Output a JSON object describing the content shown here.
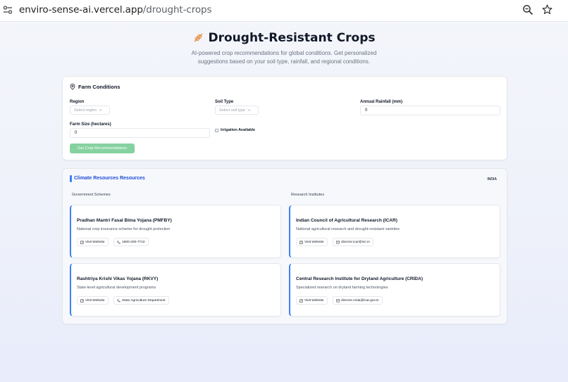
{
  "browser": {
    "url_host": "enviro-sense-ai.vercel.app",
    "url_path": "/drought-crops"
  },
  "header": {
    "title": "Drought-Resistant Crops",
    "subtitle": "AI-powered crop recommendations for global conditions. Get personalized suggestions based on your soil type, rainfall, and regional conditions."
  },
  "farm": {
    "title": "Farm Conditions",
    "region_label": "Region",
    "region_placeholder": "Select region",
    "soil_label": "Soil Type",
    "soil_placeholder": "Select soil type",
    "rainfall_label": "Annual Rainfall (mm)",
    "rainfall_value": "0",
    "size_label": "Farm Size (hectares)",
    "size_value": "0",
    "irrigation_label": "Irrigation Available",
    "submit_label": "Get Crop Recommendations"
  },
  "resources": {
    "title": "Climate Resources Resources",
    "country": "INDIA",
    "gov_heading": "Government Schemes",
    "research_heading": "Research Institutes",
    "items": [
      {
        "name": "Pradhan Mantri Fasal Bima Yojana (PMFBY)",
        "desc": "National crop insurance scheme for drought protection",
        "website": "Visit Website",
        "contact": "1800-200-7710",
        "contact_type": "phone"
      },
      {
        "name": "Indian Council of Agricultural Research (ICAR)",
        "desc": "National agricultural research and drought-resistant varieties",
        "website": "Visit Website",
        "contact": "director.icar@nic.in",
        "contact_type": "email"
      },
      {
        "name": "Rashtriya Krishi Vikas Yojana (RKVY)",
        "desc": "State-level agricultural development programs",
        "website": "Visit Website",
        "contact": "State Agriculture Department",
        "contact_type": "phone"
      },
      {
        "name": "Central Research Institute for Dryland Agriculture (CRIDA)",
        "desc": "Specialized research on dryland farming technologies",
        "website": "Visit Website",
        "contact": "director.crida@icar.gov.in",
        "contact_type": "email"
      }
    ]
  },
  "colors": {
    "accent": "#3b82f6",
    "primary_button": "#86d1a0",
    "title_orange": "#e8893a"
  }
}
